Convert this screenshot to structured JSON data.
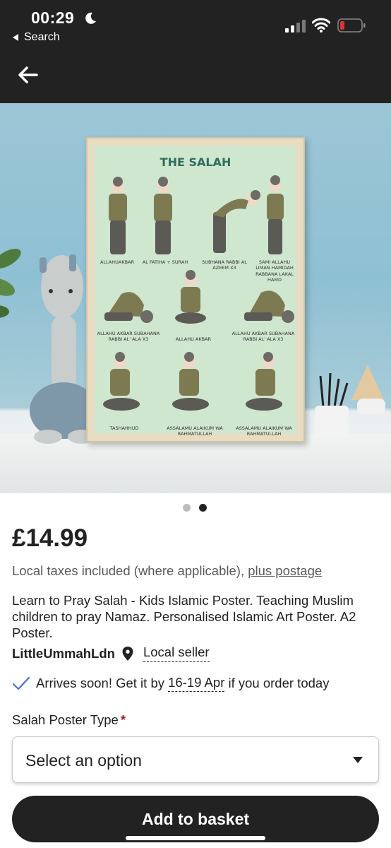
{
  "status_bar": {
    "time": "00:29",
    "back_app_label": "Search",
    "battery_color": "#e0312f"
  },
  "nav": {
    "back_icon": "arrow-left-icon"
  },
  "product_image": {
    "poster_title": "THE SALAH",
    "pose_labels": [
      "ALLAHUAKBAR",
      "AL FATIHA + SURAH",
      "SUBHANA RABBI AL AZEEM X3",
      "SAMI ALLAHU LIMAN HAMIDAH RABBANA LAKAL HAMD",
      "ALLAHU AKBAR SUBAHANA RABBI AL' ALA X3",
      "ALLAHU AKBAR",
      "ALLAHU AKBAR SUBAHANA RABBI AL' ALA X3",
      "TASHAHHUD",
      "ASSALAMU ALAIKUM WA RAHMATULLAH",
      "ASSALAMU ALAIKUM WA RAHMATULLAH"
    ],
    "image_count": 2,
    "active_index": 1
  },
  "product": {
    "price": "£14.99",
    "taxes_text": "Local taxes included (where applicable), ",
    "postage_link": "plus postage",
    "title": "Learn to Pray Salah - Kids Islamic Poster. Teaching Muslim children to pray Namaz. Personalised Islamic Art Poster. A2 Poster.",
    "seller_name": "LittleUmmahLdn",
    "local_seller_label": "Local seller",
    "arrives_prefix": "Arrives soon! Get it by ",
    "arrives_dates": "16-19 Apr",
    "arrives_suffix": " if you order today"
  },
  "variation": {
    "label": "Salah Poster Type",
    "required_mark": "*",
    "selected_value": "Select an option"
  },
  "actions": {
    "add_to_basket": "Add to basket"
  },
  "colors": {
    "dark": "#222222",
    "accent_check": "#4a6fd6",
    "required": "#a61a2e",
    "poster_bg": "#cfe6cf",
    "poster_title": "#2f6d5f"
  }
}
